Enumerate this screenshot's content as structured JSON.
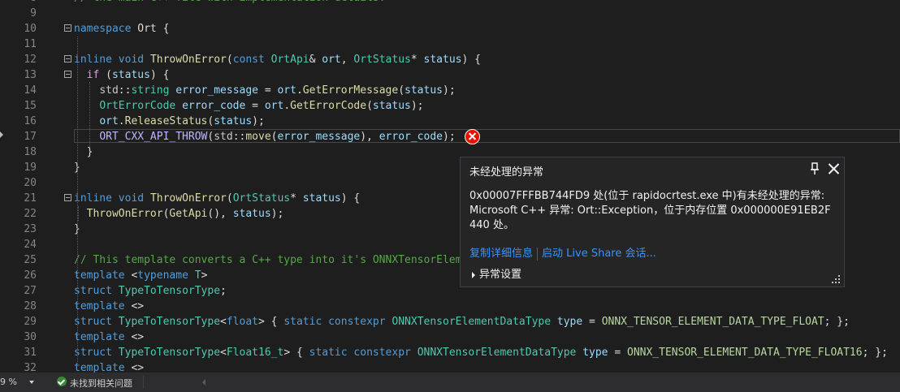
{
  "editor": {
    "lines": [
      {
        "n": "8",
        "fold": false,
        "tokens": [
          [
            "cm",
            "// the main C++ file with implementation details."
          ]
        ]
      },
      {
        "n": "9",
        "fold": false,
        "tokens": []
      },
      {
        "n": "10",
        "fold": true,
        "tokens": [
          [
            "kw",
            "namespace"
          ],
          [
            "",
            " Ort {"
          ]
        ]
      },
      {
        "n": "11",
        "fold": false,
        "tokens": []
      },
      {
        "n": "12",
        "fold": true,
        "tokens": [
          [
            "kw",
            "inline"
          ],
          [
            "",
            " "
          ],
          [
            "kw",
            "void"
          ],
          [
            "",
            " "
          ],
          [
            "fn",
            "ThrowOnError"
          ],
          [
            "",
            "("
          ],
          [
            "kw",
            "const"
          ],
          [
            "",
            " "
          ],
          [
            "ty",
            "OrtApi"
          ],
          [
            "",
            "& "
          ],
          [
            "va",
            "ort"
          ],
          [
            "",
            ", "
          ],
          [
            "ty",
            "OrtStatus"
          ],
          [
            "",
            "* "
          ],
          [
            "va",
            "status"
          ],
          [
            "",
            ") {"
          ]
        ]
      },
      {
        "n": "13",
        "fold": true,
        "tokens": [
          [
            "",
            "  "
          ],
          [
            "ctrl",
            "if"
          ],
          [
            "",
            " ("
          ],
          [
            "va",
            "status"
          ],
          [
            "",
            ") {"
          ]
        ]
      },
      {
        "n": "14",
        "fold": false,
        "tokens": [
          [
            "",
            "    "
          ],
          [
            "ns",
            "std"
          ],
          [
            "",
            "::"
          ],
          [
            "ty",
            "string"
          ],
          [
            "",
            " "
          ],
          [
            "va",
            "error_message"
          ],
          [
            "",
            " = "
          ],
          [
            "va",
            "ort"
          ],
          [
            "",
            "."
          ],
          [
            "fn",
            "GetErrorMessage"
          ],
          [
            "",
            "("
          ],
          [
            "va",
            "status"
          ],
          [
            "",
            ");"
          ]
        ]
      },
      {
        "n": "15",
        "fold": false,
        "tokens": [
          [
            "",
            "    "
          ],
          [
            "ty",
            "OrtErrorCode"
          ],
          [
            "",
            " "
          ],
          [
            "va",
            "error_code"
          ],
          [
            "",
            " = "
          ],
          [
            "va",
            "ort"
          ],
          [
            "",
            "."
          ],
          [
            "fn",
            "GetErrorCode"
          ],
          [
            "",
            "("
          ],
          [
            "va",
            "status"
          ],
          [
            "",
            ");"
          ]
        ]
      },
      {
        "n": "16",
        "fold": false,
        "tokens": [
          [
            "",
            "    "
          ],
          [
            "va",
            "ort"
          ],
          [
            "",
            "."
          ],
          [
            "fn",
            "ReleaseStatus"
          ],
          [
            "",
            "("
          ],
          [
            "va",
            "status"
          ],
          [
            "",
            ");"
          ]
        ]
      },
      {
        "n": "17",
        "fold": false,
        "tokens": [
          [
            "",
            "    "
          ],
          [
            "mc",
            "ORT_CXX_API_THROW"
          ],
          [
            "",
            "("
          ],
          [
            "ns",
            "std"
          ],
          [
            "",
            "::"
          ],
          [
            "fn",
            "move"
          ],
          [
            "",
            "("
          ],
          [
            "va",
            "error_message"
          ],
          [
            "",
            "), "
          ],
          [
            "va",
            "error_code"
          ],
          [
            "",
            ");"
          ]
        ]
      },
      {
        "n": "18",
        "fold": false,
        "tokens": [
          [
            "",
            "  }"
          ]
        ]
      },
      {
        "n": "19",
        "fold": false,
        "tokens": [
          [
            "",
            "}"
          ]
        ]
      },
      {
        "n": "20",
        "fold": false,
        "tokens": []
      },
      {
        "n": "21",
        "fold": true,
        "tokens": [
          [
            "kw",
            "inline"
          ],
          [
            "",
            " "
          ],
          [
            "kw",
            "void"
          ],
          [
            "",
            " "
          ],
          [
            "fn",
            "ThrowOnError"
          ],
          [
            "",
            "("
          ],
          [
            "ty",
            "OrtStatus"
          ],
          [
            "",
            "* "
          ],
          [
            "va",
            "status"
          ],
          [
            "",
            ") {"
          ]
        ]
      },
      {
        "n": "22",
        "fold": false,
        "tokens": [
          [
            "",
            "  "
          ],
          [
            "fn",
            "ThrowOnError"
          ],
          [
            "",
            "("
          ],
          [
            "fn",
            "GetApi"
          ],
          [
            "",
            "(), "
          ],
          [
            "va",
            "status"
          ],
          [
            "",
            ");"
          ]
        ]
      },
      {
        "n": "23",
        "fold": false,
        "tokens": [
          [
            "",
            "}"
          ]
        ]
      },
      {
        "n": "24",
        "fold": false,
        "tokens": []
      },
      {
        "n": "25",
        "fold": false,
        "tokens": [
          [
            "cm",
            "// This template converts a C++ type into it's ONNXTensorEleme"
          ]
        ]
      },
      {
        "n": "26",
        "fold": false,
        "tokens": [
          [
            "kw",
            "template"
          ],
          [
            "",
            " <"
          ],
          [
            "kw",
            "typename"
          ],
          [
            "",
            " "
          ],
          [
            "ty",
            "T"
          ],
          [
            "",
            ">"
          ]
        ]
      },
      {
        "n": "27",
        "fold": false,
        "tokens": [
          [
            "kw",
            "struct"
          ],
          [
            "",
            " "
          ],
          [
            "ty",
            "TypeToTensorType"
          ],
          [
            "",
            ";"
          ]
        ]
      },
      {
        "n": "28",
        "fold": false,
        "tokens": [
          [
            "kw",
            "template"
          ],
          [
            "",
            " <>"
          ]
        ]
      },
      {
        "n": "29",
        "fold": false,
        "tokens": [
          [
            "kw",
            "struct"
          ],
          [
            "",
            " "
          ],
          [
            "ty",
            "TypeToTensorType"
          ],
          [
            "",
            "<"
          ],
          [
            "kw",
            "float"
          ],
          [
            "",
            "> { "
          ],
          [
            "kw",
            "static"
          ],
          [
            "",
            " "
          ],
          [
            "kw",
            "constexpr"
          ],
          [
            "",
            " "
          ],
          [
            "ty",
            "ONNXTensorElementDataType"
          ],
          [
            "",
            " "
          ],
          [
            "va",
            "type"
          ],
          [
            "",
            " = "
          ],
          [
            "en",
            "ONNX_TENSOR_ELEMENT_DATA_TYPE_FLOAT"
          ],
          [
            "",
            "; };"
          ]
        ]
      },
      {
        "n": "30",
        "fold": false,
        "tokens": [
          [
            "kw",
            "template"
          ],
          [
            "",
            " <>"
          ]
        ]
      },
      {
        "n": "31",
        "fold": false,
        "tokens": [
          [
            "kw",
            "struct"
          ],
          [
            "",
            " "
          ],
          [
            "ty",
            "TypeToTensorType"
          ],
          [
            "",
            "<"
          ],
          [
            "ty",
            "Float16_t"
          ],
          [
            "",
            "> { "
          ],
          [
            "kw",
            "static"
          ],
          [
            "",
            " "
          ],
          [
            "kw",
            "constexpr"
          ],
          [
            "",
            " "
          ],
          [
            "ty",
            "ONNXTensorElementDataType"
          ],
          [
            "",
            " "
          ],
          [
            "va",
            "type"
          ],
          [
            "",
            " = "
          ],
          [
            "en",
            "ONNX_TENSOR_ELEMENT_DATA_TYPE_FLOAT16"
          ],
          [
            "",
            "; };"
          ]
        ]
      },
      {
        "n": "32",
        "fold": false,
        "tokens": [
          [
            "kw",
            "template"
          ],
          [
            "",
            " <>"
          ]
        ]
      }
    ]
  },
  "exception_popup": {
    "title": "未经处理的异常",
    "pin_icon": "pin-icon",
    "close_icon": "close-icon",
    "message": "0x00007FFFBB744FD9 处(位于 rapidocrtest.exe 中)有未经处理的异常: Microsoft C++ 异常: Ort::Exception，位于内存位置 0x000000E91EB2F440 处。",
    "copy_details_link": "复制详细信息",
    "live_share_link": "启动 Live Share 会话...",
    "exception_settings_label": "异常设置"
  },
  "status_bar": {
    "zoom": "9 %",
    "issues_text": "未找到相关问题"
  },
  "colors": {
    "editor_bg": "#1e1e1e",
    "error_red": "#e51400",
    "link_blue": "#3794ff",
    "ok_green": "#388a34"
  }
}
